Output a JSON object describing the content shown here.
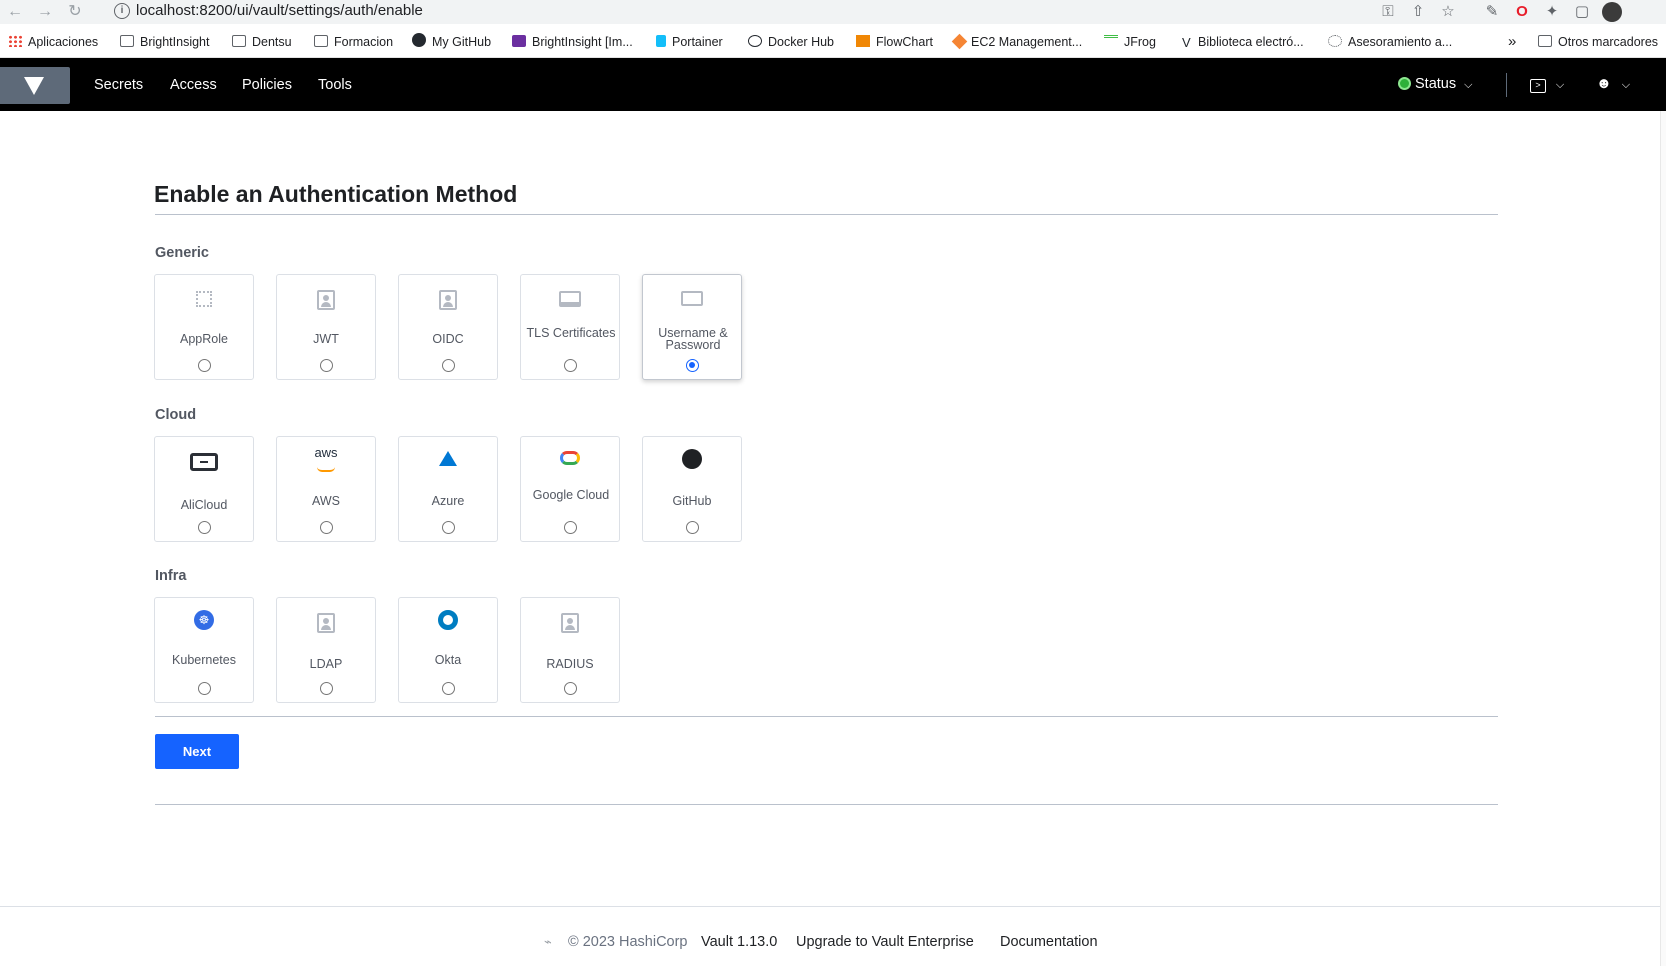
{
  "browser": {
    "url": "localhost:8200/ui/vault/settings/auth/enable",
    "bookmarks": [
      "Aplicaciones",
      "BrightInsight",
      "Dentsu",
      "Formacion",
      "My GitHub",
      "BrightInsight [Im...",
      "Portainer",
      "Docker Hub",
      "FlowChart",
      "EC2 Management...",
      "JFrog",
      "Biblioteca electró...",
      "Asesoramiento a...",
      "Otros marcadores"
    ],
    "overflow": "»"
  },
  "nav": {
    "links": [
      "Secrets",
      "Access",
      "Policies",
      "Tools"
    ],
    "status_label": "Status"
  },
  "page": {
    "title": "Enable an Authentication Method",
    "groups": {
      "generic": {
        "label": "Generic",
        "methods": [
          {
            "label": "AppRole",
            "icon": "chip-icon",
            "selected": false
          },
          {
            "label": "JWT",
            "icon": "user-doc-icon",
            "selected": false
          },
          {
            "label": "OIDC",
            "icon": "user-doc-icon",
            "selected": false
          },
          {
            "label": "TLS Certificates",
            "icon": "certificate-icon",
            "selected": false
          },
          {
            "label": "Username & Password",
            "icon": "id-card-icon",
            "selected": true
          }
        ]
      },
      "cloud": {
        "label": "Cloud",
        "methods": [
          {
            "label": "AliCloud",
            "icon": "alicloud-icon",
            "selected": false
          },
          {
            "label": "AWS",
            "icon": "aws-icon",
            "selected": false
          },
          {
            "label": "Azure",
            "icon": "azure-icon",
            "selected": false
          },
          {
            "label": "Google Cloud",
            "icon": "google-cloud-icon",
            "selected": false
          },
          {
            "label": "GitHub",
            "icon": "github-icon",
            "selected": false
          }
        ]
      },
      "infra": {
        "label": "Infra",
        "methods": [
          {
            "label": "Kubernetes",
            "icon": "kubernetes-icon",
            "selected": false
          },
          {
            "label": "LDAP",
            "icon": "user-doc-icon",
            "selected": false
          },
          {
            "label": "Okta",
            "icon": "okta-icon",
            "selected": false
          },
          {
            "label": "RADIUS",
            "icon": "user-doc-icon",
            "selected": false
          }
        ]
      }
    },
    "next_label": "Next"
  },
  "footer": {
    "copyright": "© 2023 HashiCorp",
    "version": "Vault 1.13.0",
    "upgrade": "Upgrade to Vault Enterprise",
    "docs": "Documentation"
  },
  "colors": {
    "accent": "#1563ff",
    "header_bg": "#000000",
    "status_green": "#2eb039"
  }
}
